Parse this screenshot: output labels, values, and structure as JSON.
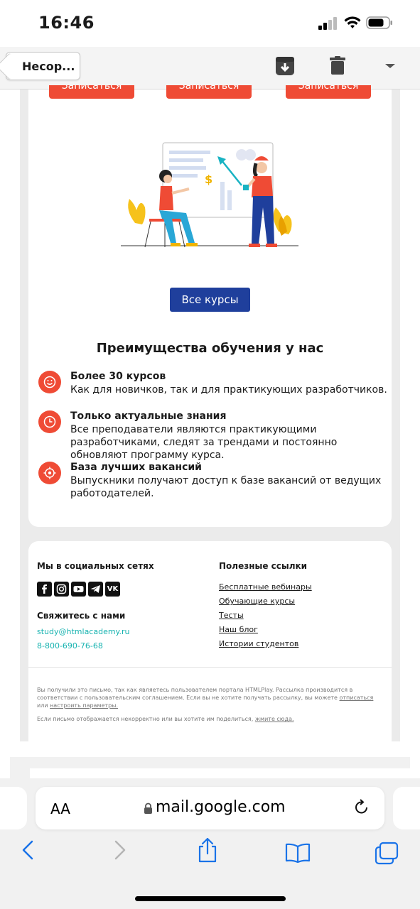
{
  "status_bar": {
    "time": "16:46"
  },
  "mail_toolbar": {
    "back_label": "Несор..."
  },
  "email": {
    "signup_label": "Записаться",
    "all_courses_label": "Все курсы",
    "advantages_title": "Преимущества обучения у нас",
    "advantages": [
      {
        "title": "Более 30 курсов",
        "text": "Как для новичков, так и для практикующих разработчиков."
      },
      {
        "title": "Только актуальные знания",
        "text": "Все преподаватели являются практикующими разработчиками, следят за трендами и постоянно обновляют программу курса."
      },
      {
        "title": "База лучших вакансий",
        "text": "Выпускники получают доступ к базе вакансий от ведущих работодателей."
      }
    ],
    "footer": {
      "social_heading": "Мы в социальных сетях",
      "social_icons": [
        "facebook-icon",
        "instagram-icon",
        "youtube-icon",
        "telegram-icon",
        "vk-icon"
      ],
      "contact_heading": "Свяжитесь с нами",
      "email": "study@htmlacademy.ru",
      "phone": "8-800-690-76-68",
      "links_heading": "Полезные ссылки",
      "links": [
        "Бесплатные вебинары",
        "Обучающие курсы",
        "Тесты",
        "Наш блог",
        "Истории студентов"
      ],
      "notice_1": "Вы получили это письмо, так как являетесь пользователем портала HTMLPlay. Рассылка производится в соответствии с пользовательским соглашением. Если вы не хотите получать рассылку, вы можете",
      "unsubscribe_label": "отписаться",
      "notice_or": "или",
      "settings_label": "настроить параметры.",
      "notice_2": "Если письмо отображается некорректно или вы хотите им поделиться,",
      "click_here_label": "жмите сюда."
    }
  },
  "safari": {
    "aa_label": "AA",
    "url": "mail.google.com"
  },
  "colors": {
    "accent": "#ef4b35",
    "button_blue": "#1f3f9c",
    "link_teal": "#17b3b0"
  }
}
